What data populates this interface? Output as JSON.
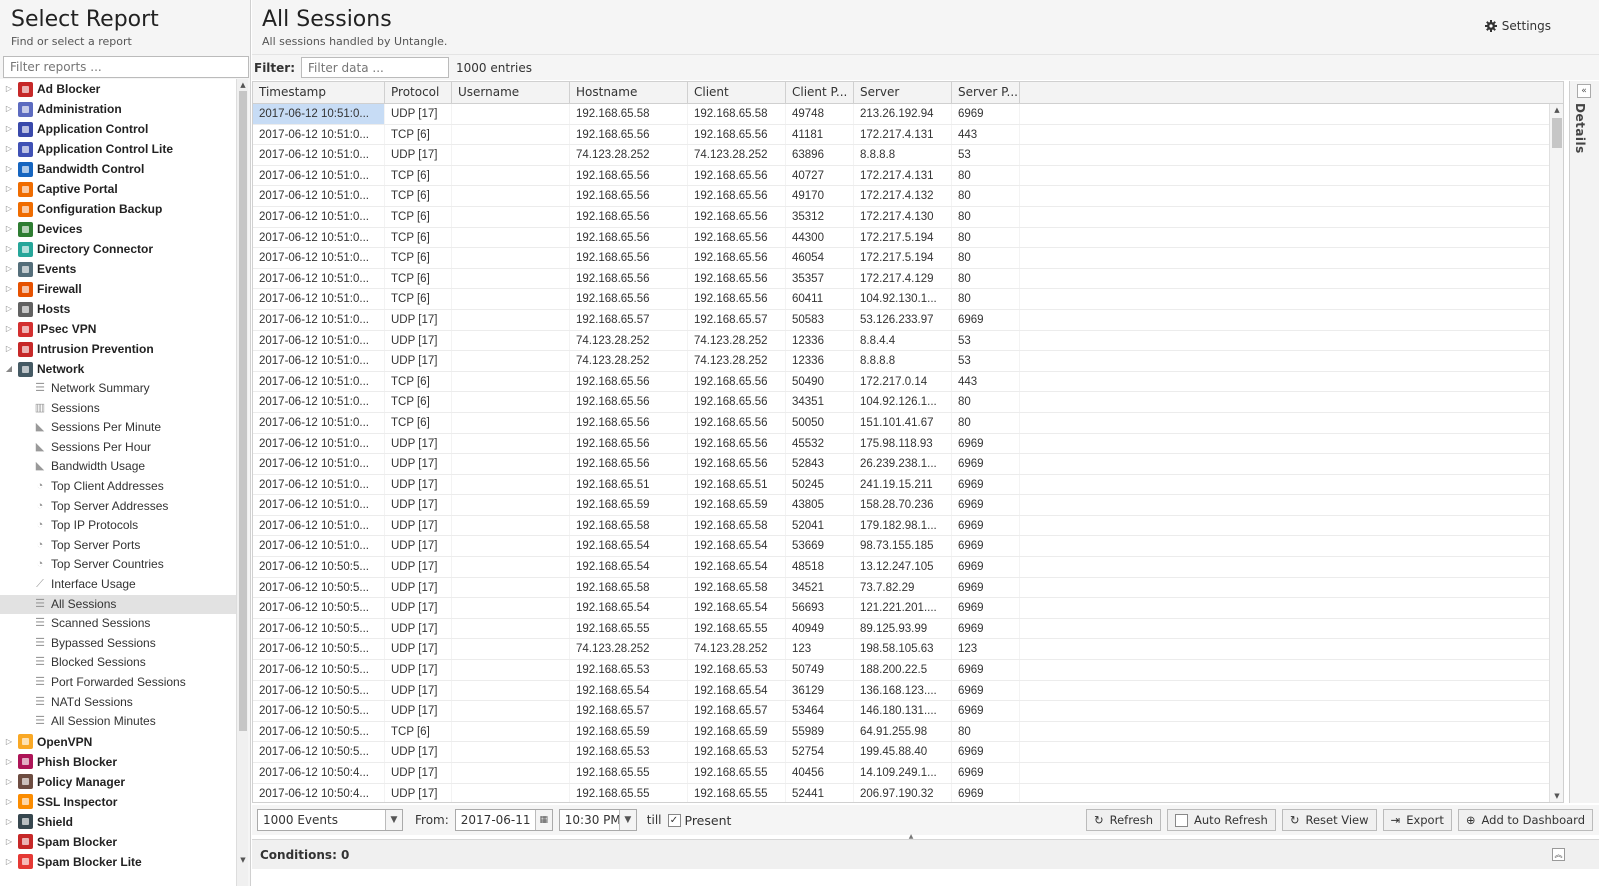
{
  "left_panel": {
    "title": "Select Report",
    "subtitle": "Find or select a report",
    "search_placeholder": "Filter reports ..."
  },
  "tree": {
    "apps_before": [
      {
        "label": "Ad Blocker",
        "color": "#c62828"
      },
      {
        "label": "Administration",
        "color": "#5c6bc0"
      },
      {
        "label": "Application Control",
        "color": "#3949ab"
      },
      {
        "label": "Application Control Lite",
        "color": "#3f51b5"
      },
      {
        "label": "Bandwidth Control",
        "color": "#1565c0"
      },
      {
        "label": "Captive Portal",
        "color": "#ef6c00"
      },
      {
        "label": "Configuration Backup",
        "color": "#ef6c00"
      },
      {
        "label": "Devices",
        "color": "#2e7d32"
      },
      {
        "label": "Directory Connector",
        "color": "#26a69a"
      },
      {
        "label": "Events",
        "color": "#546e7a"
      },
      {
        "label": "Firewall",
        "color": "#e65100"
      },
      {
        "label": "Hosts",
        "color": "#616161"
      },
      {
        "label": "IPsec VPN",
        "color": "#d32f2f"
      },
      {
        "label": "Intrusion Prevention",
        "color": "#c62828"
      },
      {
        "label": "Network",
        "color": "#455a64"
      }
    ],
    "network_children": [
      {
        "label": "Network Summary",
        "icon": "list-icon"
      },
      {
        "label": "Sessions",
        "icon": "bar-chart-icon"
      },
      {
        "label": "Sessions Per Minute",
        "icon": "area-chart-icon"
      },
      {
        "label": "Sessions Per Hour",
        "icon": "area-chart-icon"
      },
      {
        "label": "Bandwidth Usage",
        "icon": "area-chart-icon"
      },
      {
        "label": "Top Client Addresses",
        "icon": "pie-chart-icon"
      },
      {
        "label": "Top Server Addresses",
        "icon": "pie-chart-icon"
      },
      {
        "label": "Top IP Protocols",
        "icon": "pie-chart-icon"
      },
      {
        "label": "Top Server Ports",
        "icon": "pie-chart-icon"
      },
      {
        "label": "Top Server Countries",
        "icon": "pie-chart-icon"
      },
      {
        "label": "Interface Usage",
        "icon": "line-chart-icon"
      },
      {
        "label": "All Sessions",
        "icon": "list-icon"
      },
      {
        "label": "Scanned Sessions",
        "icon": "list-icon"
      },
      {
        "label": "Bypassed Sessions",
        "icon": "list-icon"
      },
      {
        "label": "Blocked Sessions",
        "icon": "list-icon"
      },
      {
        "label": "Port Forwarded Sessions",
        "icon": "list-icon"
      },
      {
        "label": "NATd Sessions",
        "icon": "list-icon"
      },
      {
        "label": "All Session Minutes",
        "icon": "list-icon"
      }
    ],
    "selected_child": "All Sessions",
    "apps_after": [
      {
        "label": "OpenVPN",
        "color": "#f9a825"
      },
      {
        "label": "Phish Blocker",
        "color": "#ad1457"
      },
      {
        "label": "Policy Manager",
        "color": "#6d4c41"
      },
      {
        "label": "SSL Inspector",
        "color": "#fb8c00"
      },
      {
        "label": "Shield",
        "color": "#37474f"
      },
      {
        "label": "Spam Blocker",
        "color": "#c62828"
      },
      {
        "label": "Spam Blocker Lite",
        "color": "#e53935"
      }
    ]
  },
  "main": {
    "title": "All Sessions",
    "subtitle": "All sessions handled by Untangle.",
    "settings_label": "Settings",
    "filter_label": "Filter:",
    "filter_placeholder": "Filter data ...",
    "entries": "1000 entries",
    "details_label": "Details"
  },
  "grid": {
    "columns": [
      "Timestamp",
      "Protocol",
      "Username",
      "Hostname",
      "Client",
      "Client P...",
      "Server",
      "Server P..."
    ],
    "rows": [
      [
        "2017-06-12 10:51:0...",
        "UDP [17]",
        "",
        "192.168.65.58",
        "192.168.65.58",
        "49748",
        "213.26.192.94",
        "6969"
      ],
      [
        "2017-06-12 10:51:0...",
        "TCP [6]",
        "",
        "192.168.65.56",
        "192.168.65.56",
        "41181",
        "172.217.4.131",
        "443"
      ],
      [
        "2017-06-12 10:51:0...",
        "UDP [17]",
        "",
        "74.123.28.252",
        "74.123.28.252",
        "63896",
        "8.8.8.8",
        "53"
      ],
      [
        "2017-06-12 10:51:0...",
        "TCP [6]",
        "",
        "192.168.65.56",
        "192.168.65.56",
        "40727",
        "172.217.4.131",
        "80"
      ],
      [
        "2017-06-12 10:51:0...",
        "TCP [6]",
        "",
        "192.168.65.56",
        "192.168.65.56",
        "49170",
        "172.217.4.132",
        "80"
      ],
      [
        "2017-06-12 10:51:0...",
        "TCP [6]",
        "",
        "192.168.65.56",
        "192.168.65.56",
        "35312",
        "172.217.4.130",
        "80"
      ],
      [
        "2017-06-12 10:51:0...",
        "TCP [6]",
        "",
        "192.168.65.56",
        "192.168.65.56",
        "44300",
        "172.217.5.194",
        "80"
      ],
      [
        "2017-06-12 10:51:0...",
        "TCP [6]",
        "",
        "192.168.65.56",
        "192.168.65.56",
        "46054",
        "172.217.5.194",
        "80"
      ],
      [
        "2017-06-12 10:51:0...",
        "TCP [6]",
        "",
        "192.168.65.56",
        "192.168.65.56",
        "35357",
        "172.217.4.129",
        "80"
      ],
      [
        "2017-06-12 10:51:0...",
        "TCP [6]",
        "",
        "192.168.65.56",
        "192.168.65.56",
        "60411",
        "104.92.130.1...",
        "80"
      ],
      [
        "2017-06-12 10:51:0...",
        "UDP [17]",
        "",
        "192.168.65.57",
        "192.168.65.57",
        "50583",
        "53.126.233.97",
        "6969"
      ],
      [
        "2017-06-12 10:51:0...",
        "UDP [17]",
        "",
        "74.123.28.252",
        "74.123.28.252",
        "12336",
        "8.8.4.4",
        "53"
      ],
      [
        "2017-06-12 10:51:0...",
        "UDP [17]",
        "",
        "74.123.28.252",
        "74.123.28.252",
        "12336",
        "8.8.8.8",
        "53"
      ],
      [
        "2017-06-12 10:51:0...",
        "TCP [6]",
        "",
        "192.168.65.56",
        "192.168.65.56",
        "50490",
        "172.217.0.14",
        "443"
      ],
      [
        "2017-06-12 10:51:0...",
        "TCP [6]",
        "",
        "192.168.65.56",
        "192.168.65.56",
        "34351",
        "104.92.126.1...",
        "80"
      ],
      [
        "2017-06-12 10:51:0...",
        "TCP [6]",
        "",
        "192.168.65.56",
        "192.168.65.56",
        "50050",
        "151.101.41.67",
        "80"
      ],
      [
        "2017-06-12 10:51:0...",
        "UDP [17]",
        "",
        "192.168.65.56",
        "192.168.65.56",
        "45532",
        "175.98.118.93",
        "6969"
      ],
      [
        "2017-06-12 10:51:0...",
        "UDP [17]",
        "",
        "192.168.65.56",
        "192.168.65.56",
        "52843",
        "26.239.238.1...",
        "6969"
      ],
      [
        "2017-06-12 10:51:0...",
        "UDP [17]",
        "",
        "192.168.65.51",
        "192.168.65.51",
        "50245",
        "241.19.15.211",
        "6969"
      ],
      [
        "2017-06-12 10:51:0...",
        "UDP [17]",
        "",
        "192.168.65.59",
        "192.168.65.59",
        "43805",
        "158.28.70.236",
        "6969"
      ],
      [
        "2017-06-12 10:51:0...",
        "UDP [17]",
        "",
        "192.168.65.58",
        "192.168.65.58",
        "52041",
        "179.182.98.1...",
        "6969"
      ],
      [
        "2017-06-12 10:51:0...",
        "UDP [17]",
        "",
        "192.168.65.54",
        "192.168.65.54",
        "53669",
        "98.73.155.185",
        "6969"
      ],
      [
        "2017-06-12 10:50:5...",
        "UDP [17]",
        "",
        "192.168.65.54",
        "192.168.65.54",
        "48518",
        "13.12.247.105",
        "6969"
      ],
      [
        "2017-06-12 10:50:5...",
        "UDP [17]",
        "",
        "192.168.65.58",
        "192.168.65.58",
        "34521",
        "73.7.82.29",
        "6969"
      ],
      [
        "2017-06-12 10:50:5...",
        "UDP [17]",
        "",
        "192.168.65.54",
        "192.168.65.54",
        "56693",
        "121.221.201....",
        "6969"
      ],
      [
        "2017-06-12 10:50:5...",
        "UDP [17]",
        "",
        "192.168.65.55",
        "192.168.65.55",
        "40949",
        "89.125.93.99",
        "6969"
      ],
      [
        "2017-06-12 10:50:5...",
        "UDP [17]",
        "",
        "74.123.28.252",
        "74.123.28.252",
        "123",
        "198.58.105.63",
        "123"
      ],
      [
        "2017-06-12 10:50:5...",
        "UDP [17]",
        "",
        "192.168.65.53",
        "192.168.65.53",
        "50749",
        "188.200.22.5",
        "6969"
      ],
      [
        "2017-06-12 10:50:5...",
        "UDP [17]",
        "",
        "192.168.65.54",
        "192.168.65.54",
        "36129",
        "136.168.123....",
        "6969"
      ],
      [
        "2017-06-12 10:50:5...",
        "UDP [17]",
        "",
        "192.168.65.57",
        "192.168.65.57",
        "53464",
        "146.180.131....",
        "6969"
      ],
      [
        "2017-06-12 10:50:5...",
        "TCP [6]",
        "",
        "192.168.65.59",
        "192.168.65.59",
        "55989",
        "64.91.255.98",
        "80"
      ],
      [
        "2017-06-12 10:50:5...",
        "UDP [17]",
        "",
        "192.168.65.53",
        "192.168.65.53",
        "52754",
        "199.45.88.40",
        "6969"
      ],
      [
        "2017-06-12 10:50:4...",
        "UDP [17]",
        "",
        "192.168.65.55",
        "192.168.65.55",
        "40456",
        "14.109.249.1...",
        "6969"
      ],
      [
        "2017-06-12 10:50:4...",
        "UDP [17]",
        "",
        "192.168.65.55",
        "192.168.65.55",
        "52441",
        "206.97.190.32",
        "6969"
      ]
    ]
  },
  "toolbar": {
    "events_select": "1000 Events",
    "from_label": "From:",
    "from_date": "2017-06-11",
    "from_time": "10:30 PM",
    "till_label": "till",
    "present_label": "Present",
    "refresh": "Refresh",
    "auto_refresh": "Auto Refresh",
    "reset_view": "Reset View",
    "export": "Export",
    "add_to_dashboard": "Add to Dashboard"
  },
  "conditions": {
    "label": "Conditions: 0"
  }
}
